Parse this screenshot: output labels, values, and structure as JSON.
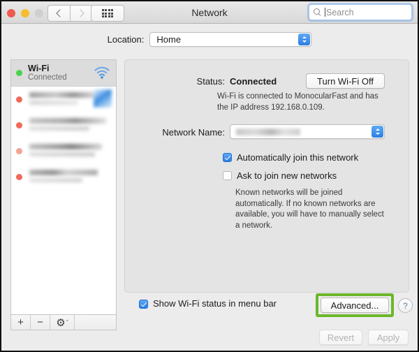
{
  "window": {
    "title": "Network",
    "traffic_lights": [
      "close",
      "minimize",
      "zoom"
    ]
  },
  "toolbar": {
    "back_icon": "chevron-left-icon",
    "forward_icon": "chevron-right-icon",
    "showall_icon": "grid-icon",
    "search": {
      "placeholder": "Search",
      "value": "",
      "icon": "search-icon"
    }
  },
  "location": {
    "label": "Location:",
    "value": "Home",
    "options": [
      "Home"
    ]
  },
  "sidebar": {
    "selected": {
      "name": "Wi-Fi",
      "state": "Connected",
      "status_color": "#4cd24c",
      "icon": "wifi-icon"
    },
    "other_services": [
      {
        "name": "",
        "state": "",
        "status_color": "#f06a5a",
        "redacted": true
      },
      {
        "name": "",
        "state": "",
        "status_color": "#f06a5a",
        "redacted": true
      },
      {
        "name": "",
        "state": "",
        "status_color": "#f06a5a",
        "redacted": true
      },
      {
        "name": "",
        "state": "",
        "status_color": "#f06a5a",
        "redacted": true
      }
    ],
    "toolbar": {
      "add_label": "+",
      "remove_label": "−",
      "gear_label": "⚙",
      "gear_chevron": "ˇ"
    }
  },
  "main": {
    "status_label": "Status:",
    "status_value": "Connected",
    "toggle_button": "Turn Wi-Fi Off",
    "status_description": "Wi-Fi is connected to MonocularFast and has the IP address 192.168.0.109.",
    "network_name_label": "Network Name:",
    "network_name_value": "",
    "checkboxes": [
      {
        "label": "Automatically join this network",
        "checked": true
      },
      {
        "label": "Ask to join new networks",
        "checked": false
      }
    ],
    "help_text": "Known networks will be joined automatically. If no known networks are available, you will have to manually select a network."
  },
  "bottom": {
    "menu_bar_checkbox": {
      "label": "Show Wi-Fi status in menu bar",
      "checked": true
    },
    "advanced_button": "Advanced...",
    "advanced_highlight_color": "#6cb72b",
    "help_button": "?",
    "revert_button": "Revert",
    "apply_button": "Apply",
    "revert_enabled": false,
    "apply_enabled": false
  }
}
